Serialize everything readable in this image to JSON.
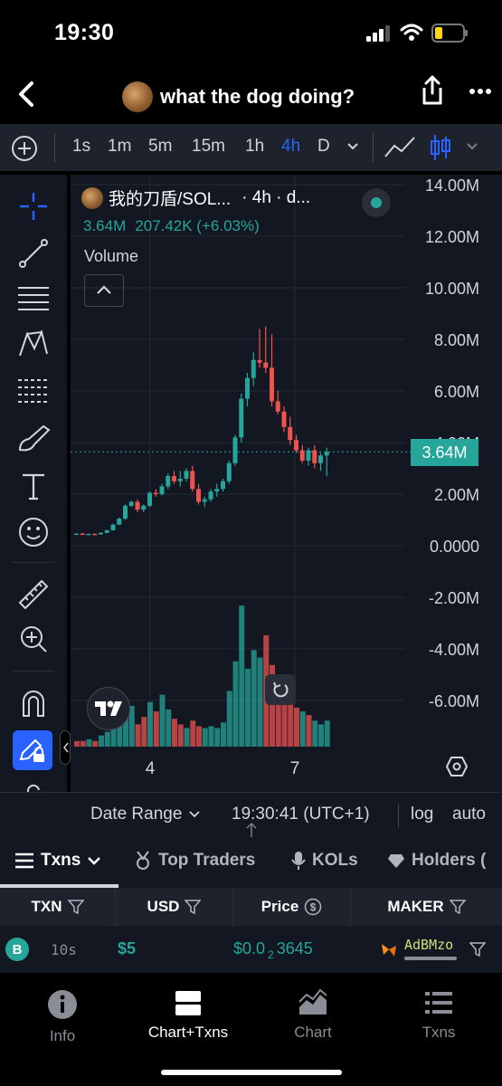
{
  "status_bar": {
    "time": "19:30"
  },
  "header": {
    "title": "what the dog doing?"
  },
  "toolbar": {
    "timeframes": [
      "1s",
      "1m",
      "5m",
      "15m",
      "1h",
      "4h",
      "D"
    ],
    "active_timeframe": "4h"
  },
  "chart": {
    "symbol": "我的刀盾/SOL...",
    "interval_suffix": "· 4h · d...",
    "price": "3.64M",
    "change": "207.42K (+6.03%)",
    "volume_label": "Volume",
    "current_price_label": "3.64M",
    "y_axis_labels": [
      "14.00M",
      "12.00M",
      "10.00M",
      "8.00M",
      "6.00M",
      "4.00M",
      "2.00M",
      "0.0000",
      "-2.00M",
      "-4.00M",
      "-6.00M"
    ],
    "x_axis_labels": [
      "4",
      "7"
    ],
    "colors": {
      "up": "#26a69a",
      "down": "#ef5350",
      "background": "#131722",
      "accent": "#2962ff"
    }
  },
  "chart_data": {
    "type": "candlestick",
    "y_unit": "market cap",
    "ylim": [
      -7000000,
      14500000
    ],
    "candles": [
      [
        0.45,
        0.48,
        0.42,
        0.47
      ],
      [
        0.47,
        0.49,
        0.43,
        0.44
      ],
      [
        0.44,
        0.47,
        0.41,
        0.46
      ],
      [
        0.46,
        0.48,
        0.43,
        0.44
      ],
      [
        0.44,
        0.52,
        0.43,
        0.5
      ],
      [
        0.5,
        0.62,
        0.49,
        0.6
      ],
      [
        0.6,
        0.85,
        0.58,
        0.82
      ],
      [
        0.82,
        1.1,
        0.8,
        1.05
      ],
      [
        1.05,
        1.6,
        1.0,
        1.55
      ],
      [
        1.55,
        1.75,
        1.5,
        1.7
      ],
      [
        1.7,
        1.8,
        1.3,
        1.4
      ],
      [
        1.4,
        1.6,
        1.3,
        1.55
      ],
      [
        1.55,
        2.1,
        1.5,
        2.05
      ],
      [
        2.05,
        2.2,
        1.9,
        2.0
      ],
      [
        2.0,
        2.4,
        1.95,
        2.3
      ],
      [
        2.3,
        2.8,
        2.2,
        2.7
      ],
      [
        2.7,
        2.9,
        2.4,
        2.5
      ],
      [
        2.5,
        2.9,
        2.3,
        2.6
      ],
      [
        2.6,
        3.0,
        2.5,
        2.9
      ],
      [
        2.9,
        3.1,
        2.1,
        2.2
      ],
      [
        2.2,
        2.4,
        1.6,
        1.7
      ],
      [
        1.7,
        1.9,
        1.5,
        1.8
      ],
      [
        1.8,
        2.2,
        1.7,
        2.1
      ],
      [
        2.1,
        2.4,
        1.9,
        2.2
      ],
      [
        2.2,
        2.6,
        2.1,
        2.5
      ],
      [
        2.5,
        3.3,
        2.4,
        3.2
      ],
      [
        3.2,
        4.3,
        3.1,
        4.2
      ],
      [
        4.2,
        5.9,
        4.0,
        5.7
      ],
      [
        5.7,
        6.7,
        5.4,
        6.5
      ],
      [
        6.5,
        7.5,
        6.2,
        7.2
      ],
      [
        7.2,
        8.4,
        6.9,
        7.1
      ],
      [
        7.1,
        8.5,
        6.7,
        6.9
      ],
      [
        6.9,
        8.2,
        5.4,
        5.6
      ],
      [
        5.6,
        6.0,
        5.1,
        5.2
      ],
      [
        5.2,
        5.4,
        4.4,
        4.6
      ],
      [
        4.6,
        5.0,
        3.9,
        4.1
      ],
      [
        4.1,
        4.3,
        3.6,
        3.7
      ],
      [
        3.7,
        3.9,
        3.2,
        3.3
      ],
      [
        3.3,
        3.8,
        3.1,
        3.7
      ],
      [
        3.7,
        3.9,
        3.0,
        3.2
      ],
      [
        3.2,
        3.6,
        2.9,
        3.5
      ],
      [
        3.5,
        3.8,
        2.7,
        3.64
      ]
    ],
    "volumes": [
      [
        0.3,
        "down"
      ],
      [
        0.3,
        "down"
      ],
      [
        0.4,
        "up"
      ],
      [
        0.3,
        "down"
      ],
      [
        0.6,
        "up"
      ],
      [
        0.8,
        "up"
      ],
      [
        1.4,
        "up"
      ],
      [
        2.0,
        "up"
      ],
      [
        2.6,
        "up"
      ],
      [
        2.2,
        "up"
      ],
      [
        1.2,
        "down"
      ],
      [
        1.6,
        "down"
      ],
      [
        2.4,
        "up"
      ],
      [
        1.9,
        "down"
      ],
      [
        2.8,
        "up"
      ],
      [
        2.0,
        "up"
      ],
      [
        1.5,
        "down"
      ],
      [
        1.2,
        "down"
      ],
      [
        1.0,
        "up"
      ],
      [
        1.4,
        "down"
      ],
      [
        1.1,
        "down"
      ],
      [
        1.0,
        "up"
      ],
      [
        1.1,
        "up"
      ],
      [
        1.0,
        "up"
      ],
      [
        1.3,
        "up"
      ],
      [
        3.0,
        "up"
      ],
      [
        4.6,
        "up"
      ],
      [
        7.6,
        "up"
      ],
      [
        4.2,
        "up"
      ],
      [
        5.2,
        "up"
      ],
      [
        4.8,
        "up"
      ],
      [
        6.0,
        "down"
      ],
      [
        4.4,
        "down"
      ],
      [
        3.2,
        "down"
      ],
      [
        3.0,
        "down"
      ],
      [
        2.4,
        "down"
      ],
      [
        2.1,
        "down"
      ],
      [
        1.9,
        "up"
      ],
      [
        1.7,
        "down"
      ],
      [
        1.4,
        "up"
      ],
      [
        1.2,
        "up"
      ],
      [
        1.4,
        "up"
      ]
    ]
  },
  "datebar": {
    "range_label": "Date Range",
    "time": "19:30:41 (UTC+1)",
    "log": "log",
    "auto": "auto"
  },
  "tabs": [
    "Txns",
    "Top Traders",
    "KOLs",
    "Holders ("
  ],
  "table": {
    "headers": [
      "TXN",
      "USD",
      "Price",
      "MAKER"
    ],
    "rows": [
      {
        "type": "B",
        "age": "10s",
        "usd": "$5",
        "price_prefix": "$0.0",
        "price_sub": "2",
        "price_rest": "3645",
        "maker": "AdBMzo"
      }
    ]
  },
  "bottom_nav": [
    "Info",
    "Chart+Txns",
    "Chart",
    "Txns"
  ]
}
